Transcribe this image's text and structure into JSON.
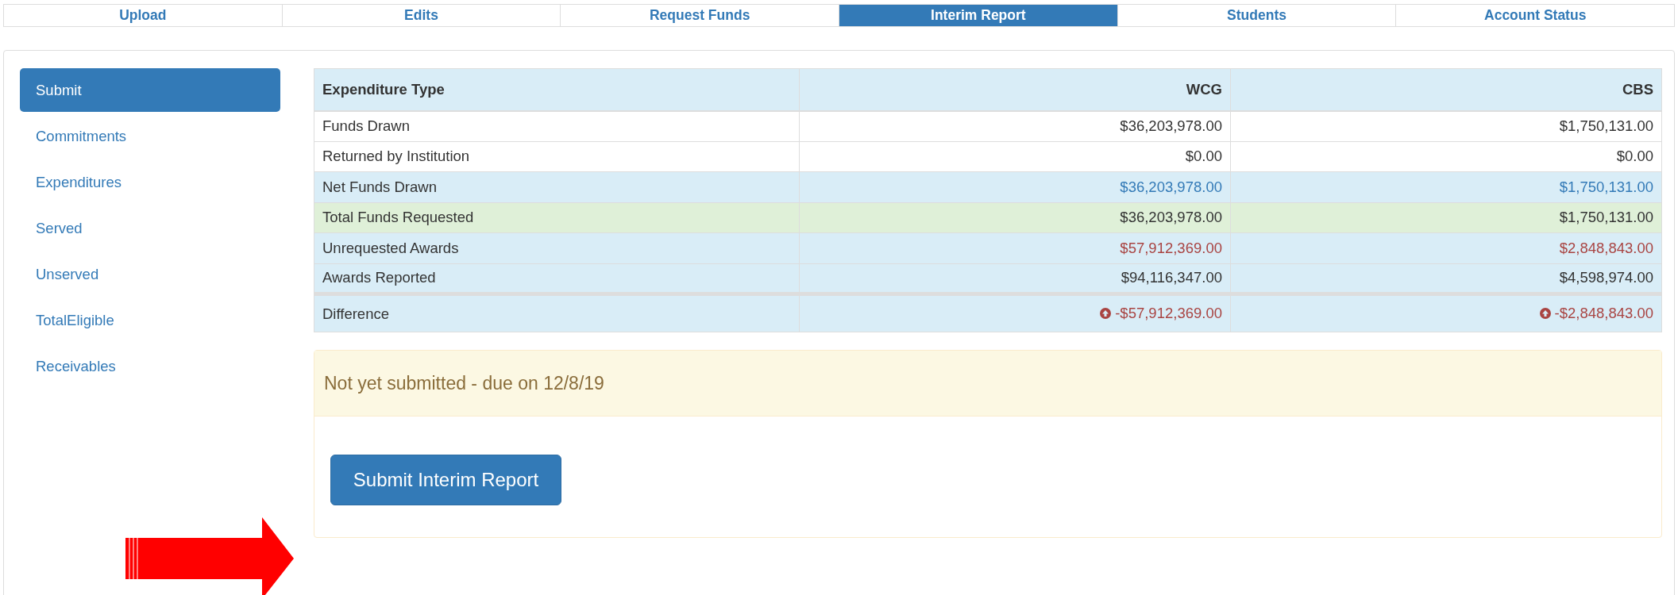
{
  "nav_tabs": [
    {
      "label": "Upload",
      "selected": false
    },
    {
      "label": "Edits",
      "selected": false
    },
    {
      "label": "Request Funds",
      "selected": false
    },
    {
      "label": "Interim Report",
      "selected": true
    },
    {
      "label": "Students",
      "selected": false
    },
    {
      "label": "Account Status",
      "selected": false
    }
  ],
  "sidebar": {
    "items": [
      {
        "label": "Submit",
        "selected": true
      },
      {
        "label": "Commitments",
        "selected": false
      },
      {
        "label": "Expenditures",
        "selected": false
      },
      {
        "label": "Served",
        "selected": false
      },
      {
        "label": "Unserved",
        "selected": false
      },
      {
        "label": "TotalEligible",
        "selected": false
      },
      {
        "label": "Receivables",
        "selected": false
      }
    ]
  },
  "table": {
    "columns": [
      "Expenditure Type",
      "WCG",
      "CBS"
    ],
    "rows": [
      {
        "kind": "plain",
        "cells": [
          "Funds Drawn",
          "$36,203,978.00",
          "$1,750,131.00"
        ]
      },
      {
        "kind": "plain",
        "cells": [
          "Returned by Institution",
          "$0.00",
          "$0.00"
        ]
      },
      {
        "kind": "info_link",
        "cells": [
          "Net Funds Drawn",
          "$36,203,978.00",
          "$1,750,131.00"
        ]
      },
      {
        "kind": "success",
        "cells": [
          "Total Funds Requested",
          "$36,203,978.00",
          "$1,750,131.00"
        ]
      },
      {
        "kind": "info_danger",
        "cells": [
          "Unrequested Awards",
          "$57,912,369.00",
          "$2,848,843.00"
        ]
      },
      {
        "kind": "info",
        "cells": [
          "Awards Reported",
          "$94,116,347.00",
          "$4,598,974.00"
        ]
      },
      {
        "kind": "difference",
        "cells": [
          "Difference",
          "-$57,912,369.00",
          "-$2,848,843.00"
        ]
      }
    ]
  },
  "alert": {
    "heading": "Not yet submitted - due on 12/8/19",
    "button": "Submit Interim Report"
  }
}
